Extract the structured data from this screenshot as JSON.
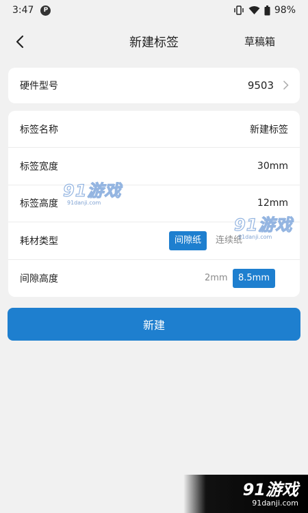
{
  "status_bar": {
    "time": "3:47",
    "battery": "98%",
    "icons": [
      "app-notification-icon",
      "vibrate-icon",
      "wifi-icon",
      "battery-icon"
    ]
  },
  "header": {
    "title": "新建标签",
    "drafts_label": "草稿箱",
    "back_icon": "chevron-left-icon"
  },
  "hardware": {
    "label": "硬件型号",
    "value": "9503"
  },
  "form": {
    "name": {
      "label": "标签名称",
      "value": "新建标签"
    },
    "width": {
      "label": "标签宽度",
      "value": "30mm"
    },
    "height": {
      "label": "标签高度",
      "value": "12mm"
    },
    "material": {
      "label": "耗材类型",
      "options": [
        "间隙纸",
        "连续纸"
      ],
      "selected": "间隙纸"
    },
    "gap": {
      "label": "间隙高度",
      "options": [
        "2mm",
        "8.5mm"
      ],
      "selected": "8.5mm"
    }
  },
  "submit_label": "新建",
  "watermark": {
    "main": "91游戏",
    "sub": "91danji.com",
    "corner_main": "91游戏",
    "corner_sub": "91danji.com"
  },
  "colors": {
    "accent": "#1e7fcf",
    "background": "#f1f1f1",
    "card": "#ffffff"
  }
}
